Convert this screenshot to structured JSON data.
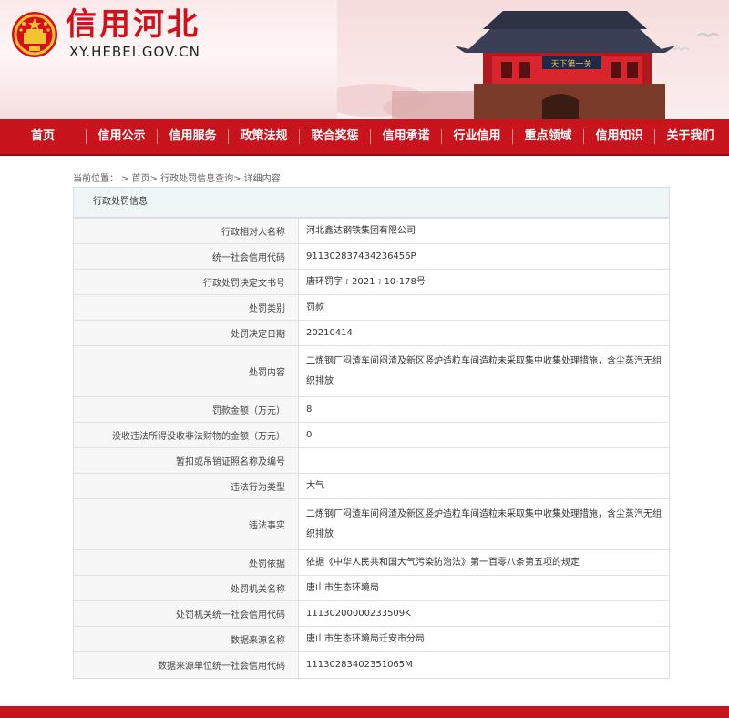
{
  "header": {
    "title": "信用河北",
    "url": "XY.HEBEI.GOV.CN",
    "banner_text": "天下第一关"
  },
  "nav": {
    "items": [
      "首页",
      "信用公示",
      "信用服务",
      "政策法规",
      "联合奖惩",
      "信用承诺",
      "行业信用",
      "重点领域",
      "信用知识",
      "关于我们"
    ]
  },
  "breadcrumb": {
    "prefix": "当前位置：",
    "path": "> 首页> 行政处罚信息查询> 详细内容"
  },
  "panel": {
    "title": "行政处罚信息"
  },
  "rows": [
    {
      "label": "行政相对人名称",
      "value": "河北鑫达钢铁集团有限公司"
    },
    {
      "label": "统一社会信用代码",
      "value": "911302837434236456P"
    },
    {
      "label": "行政处罚决定文书号",
      "value": "唐环罚字﹝2021﹞10-178号"
    },
    {
      "label": "处罚类别",
      "value": "罚款"
    },
    {
      "label": "处罚决定日期",
      "value": "20210414"
    },
    {
      "label": "处罚内容",
      "value": "二炼钢厂闷渣车间闷渣及新区竖炉造粒车间造粒未采取集中收集处理措施，含尘蒸汽无组织排放"
    },
    {
      "label": "罚款金额（万元）",
      "value": "8"
    },
    {
      "label": "没收违法所得没收非法财物的金额（万元）",
      "value": "0"
    },
    {
      "label": "暂扣或吊销证照名称及编号",
      "value": ""
    },
    {
      "label": "违法行为类型",
      "value": "大气"
    },
    {
      "label": "违法事实",
      "value": "二炼钢厂闷渣车间闷渣及新区竖炉造粒车间造粒未采取集中收集处理措施，含尘蒸汽无组织排放"
    },
    {
      "label": "处罚依据",
      "value": "依据《中华人民共和国大气污染防治法》第一百零八条第五项的规定"
    },
    {
      "label": "处罚机关名称",
      "value": "唐山市生态环境局"
    },
    {
      "label": "处罚机关统一社会信用代码",
      "value": "11130200000233509K"
    },
    {
      "label": "数据来源名称",
      "value": "唐山市生态环境局迁安市分局"
    },
    {
      "label": "数据来源单位统一社会信用代码",
      "value": "11130283402351065M"
    }
  ],
  "colors": {
    "brand_red": "#c8141c",
    "panel_header_bg": "#eef5f8",
    "label_bg": "#f7f7f7"
  }
}
